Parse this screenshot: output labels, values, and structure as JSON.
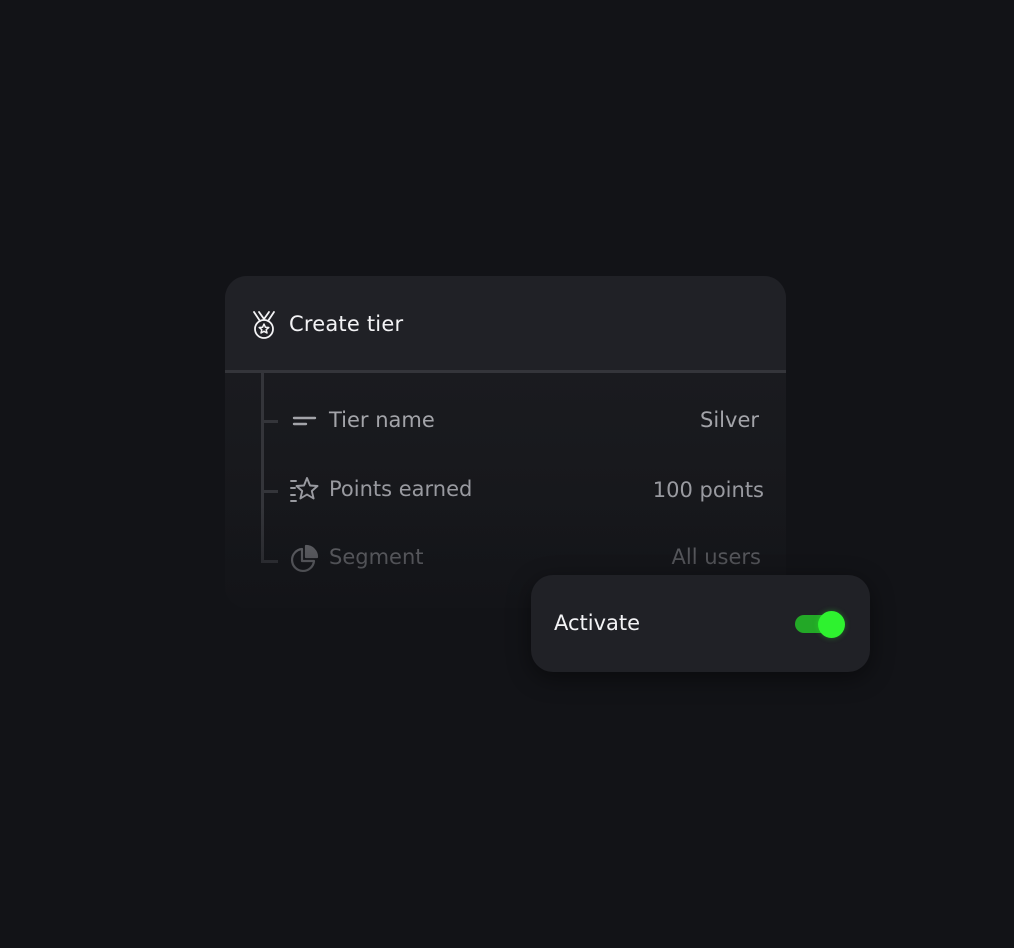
{
  "card": {
    "title": "Create tier",
    "icon": "medal-icon",
    "rows": [
      {
        "label": "Tier name",
        "value": "Silver",
        "icon": "text-lines-icon"
      },
      {
        "label": "Points earned",
        "value": "100 points",
        "icon": "star-list-icon"
      },
      {
        "label": "Segment",
        "value": "All users",
        "icon": "pie-chart-icon"
      }
    ]
  },
  "activate": {
    "label": "Activate",
    "enabled": true
  },
  "colors": {
    "background": "#121317",
    "card": "#202126",
    "toggle_on": "#2ef22f",
    "toggle_track": "#23a827"
  }
}
